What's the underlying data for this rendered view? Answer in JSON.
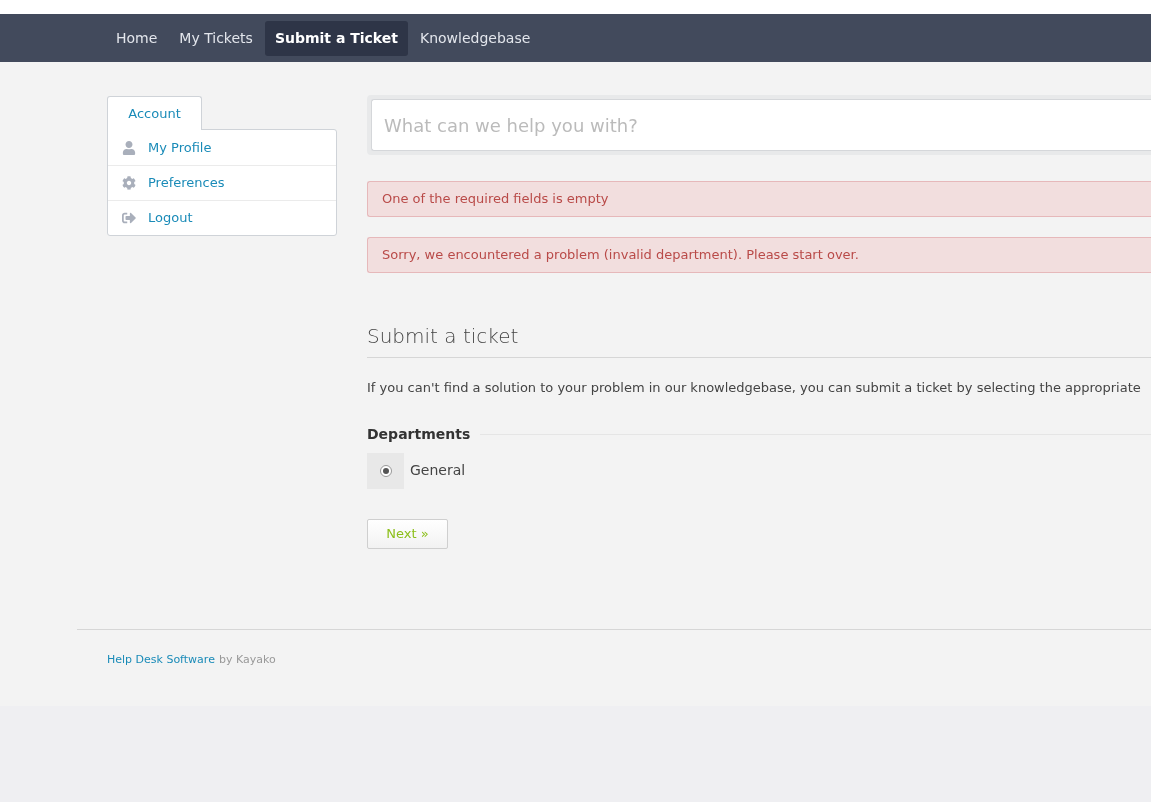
{
  "nav": {
    "items": [
      {
        "label": "Home",
        "selected": false
      },
      {
        "label": "My Tickets",
        "selected": false
      },
      {
        "label": "Submit a Ticket",
        "selected": true
      },
      {
        "label": "Knowledgebase",
        "selected": false
      }
    ]
  },
  "sidebar": {
    "tab": "Account",
    "items": [
      {
        "kind": "profile",
        "label": "My Profile"
      },
      {
        "kind": "preferences",
        "label": "Preferences"
      },
      {
        "kind": "logout",
        "label": "Logout"
      }
    ]
  },
  "search": {
    "placeholder": "What can we help you with?"
  },
  "alerts": [
    "One of the required fields is empty",
    "Sorry, we encountered a problem (invalid department). Please start over."
  ],
  "form": {
    "title": "Submit a ticket",
    "intro": "If you can't find a solution to your problem in our knowledgebase, you can submit a ticket by selecting the appropriate",
    "departments_label": "Departments",
    "departments": [
      {
        "label": "General",
        "selected": true
      }
    ],
    "next_button": "Next »"
  },
  "footer": {
    "link": "Help Desk Software",
    "suffix": "by Kayako"
  }
}
